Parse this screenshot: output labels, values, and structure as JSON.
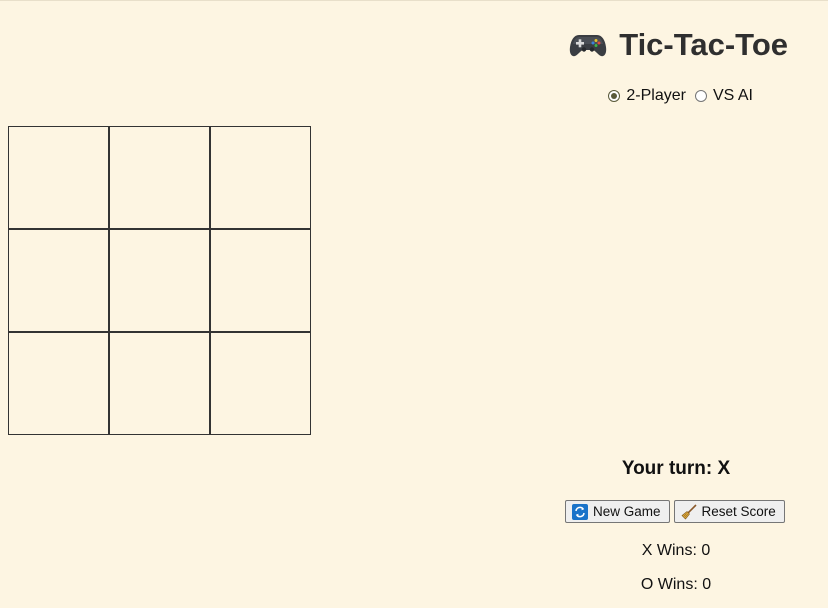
{
  "game": {
    "title": "Tic-Tac-Toe",
    "title_icon": "game-controller-icon",
    "board": [
      "",
      "",
      "",
      "",
      "",
      "",
      "",
      "",
      ""
    ],
    "turn_text": "Your turn: X"
  },
  "mode": {
    "selected": "2-Player",
    "options": [
      "2-Player",
      "VS AI"
    ]
  },
  "controls": {
    "new_game_label": "New Game",
    "new_game_icon": "refresh-icon",
    "reset_label": "Reset Score",
    "reset_icon": "broom-icon"
  },
  "score": {
    "x_text": "X Wins: 0",
    "o_text": "O Wins: 0"
  },
  "colors": {
    "background": "#fdf5e2",
    "grid_lines": "#333333",
    "title_text": "#2f2f2f"
  }
}
